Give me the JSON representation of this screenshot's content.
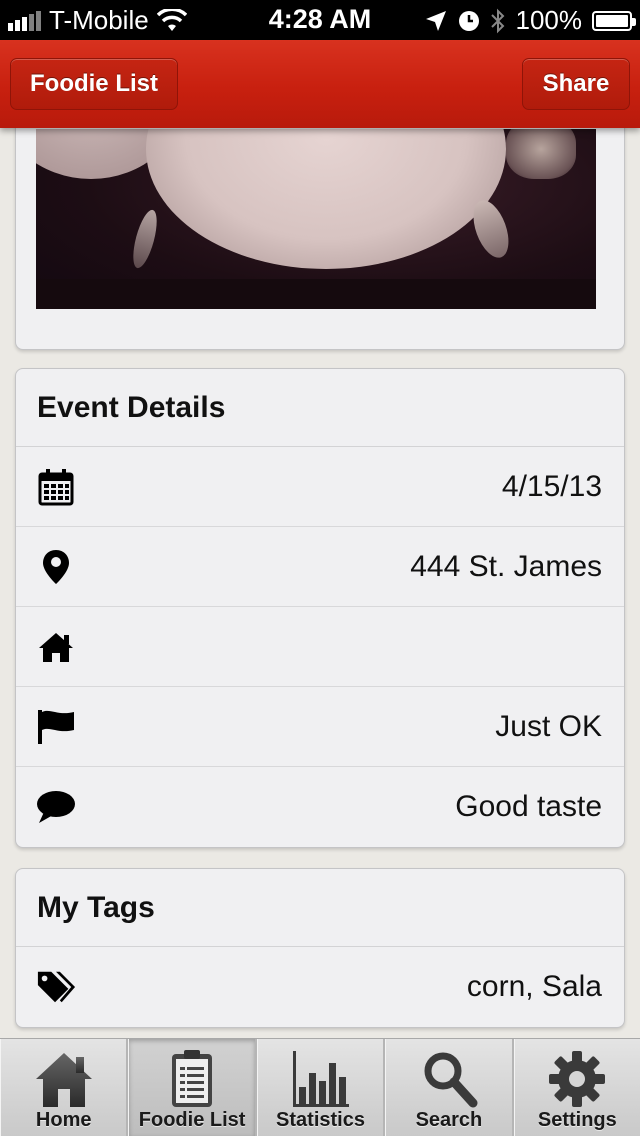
{
  "status_bar": {
    "carrier": "T-Mobile",
    "time": "4:28 AM",
    "battery": "100%"
  },
  "nav": {
    "back_label": "Foodie List",
    "share_label": "Share"
  },
  "event_details": {
    "title": "Event Details",
    "rows": [
      {
        "icon": "calendar-icon",
        "value": "4/15/13"
      },
      {
        "icon": "map-pin-icon",
        "value": "444 St. James"
      },
      {
        "icon": "home-icon",
        "value": ""
      },
      {
        "icon": "flag-icon",
        "value": "Just OK"
      },
      {
        "icon": "speech-bubble-icon",
        "value": "Good taste"
      }
    ]
  },
  "tags": {
    "title": "My Tags",
    "value": "corn, Sala",
    "icon": "tags-icon"
  },
  "tab_bar": {
    "tabs": [
      {
        "label": "Home",
        "icon": "home-icon",
        "active": false
      },
      {
        "label": "Foodie List",
        "icon": "clipboard-icon",
        "active": true
      },
      {
        "label": "Statistics",
        "icon": "bar-chart-icon",
        "active": false
      },
      {
        "label": "Search",
        "icon": "magnifier-icon",
        "active": false
      },
      {
        "label": "Settings",
        "icon": "gear-icon",
        "active": false
      }
    ]
  }
}
